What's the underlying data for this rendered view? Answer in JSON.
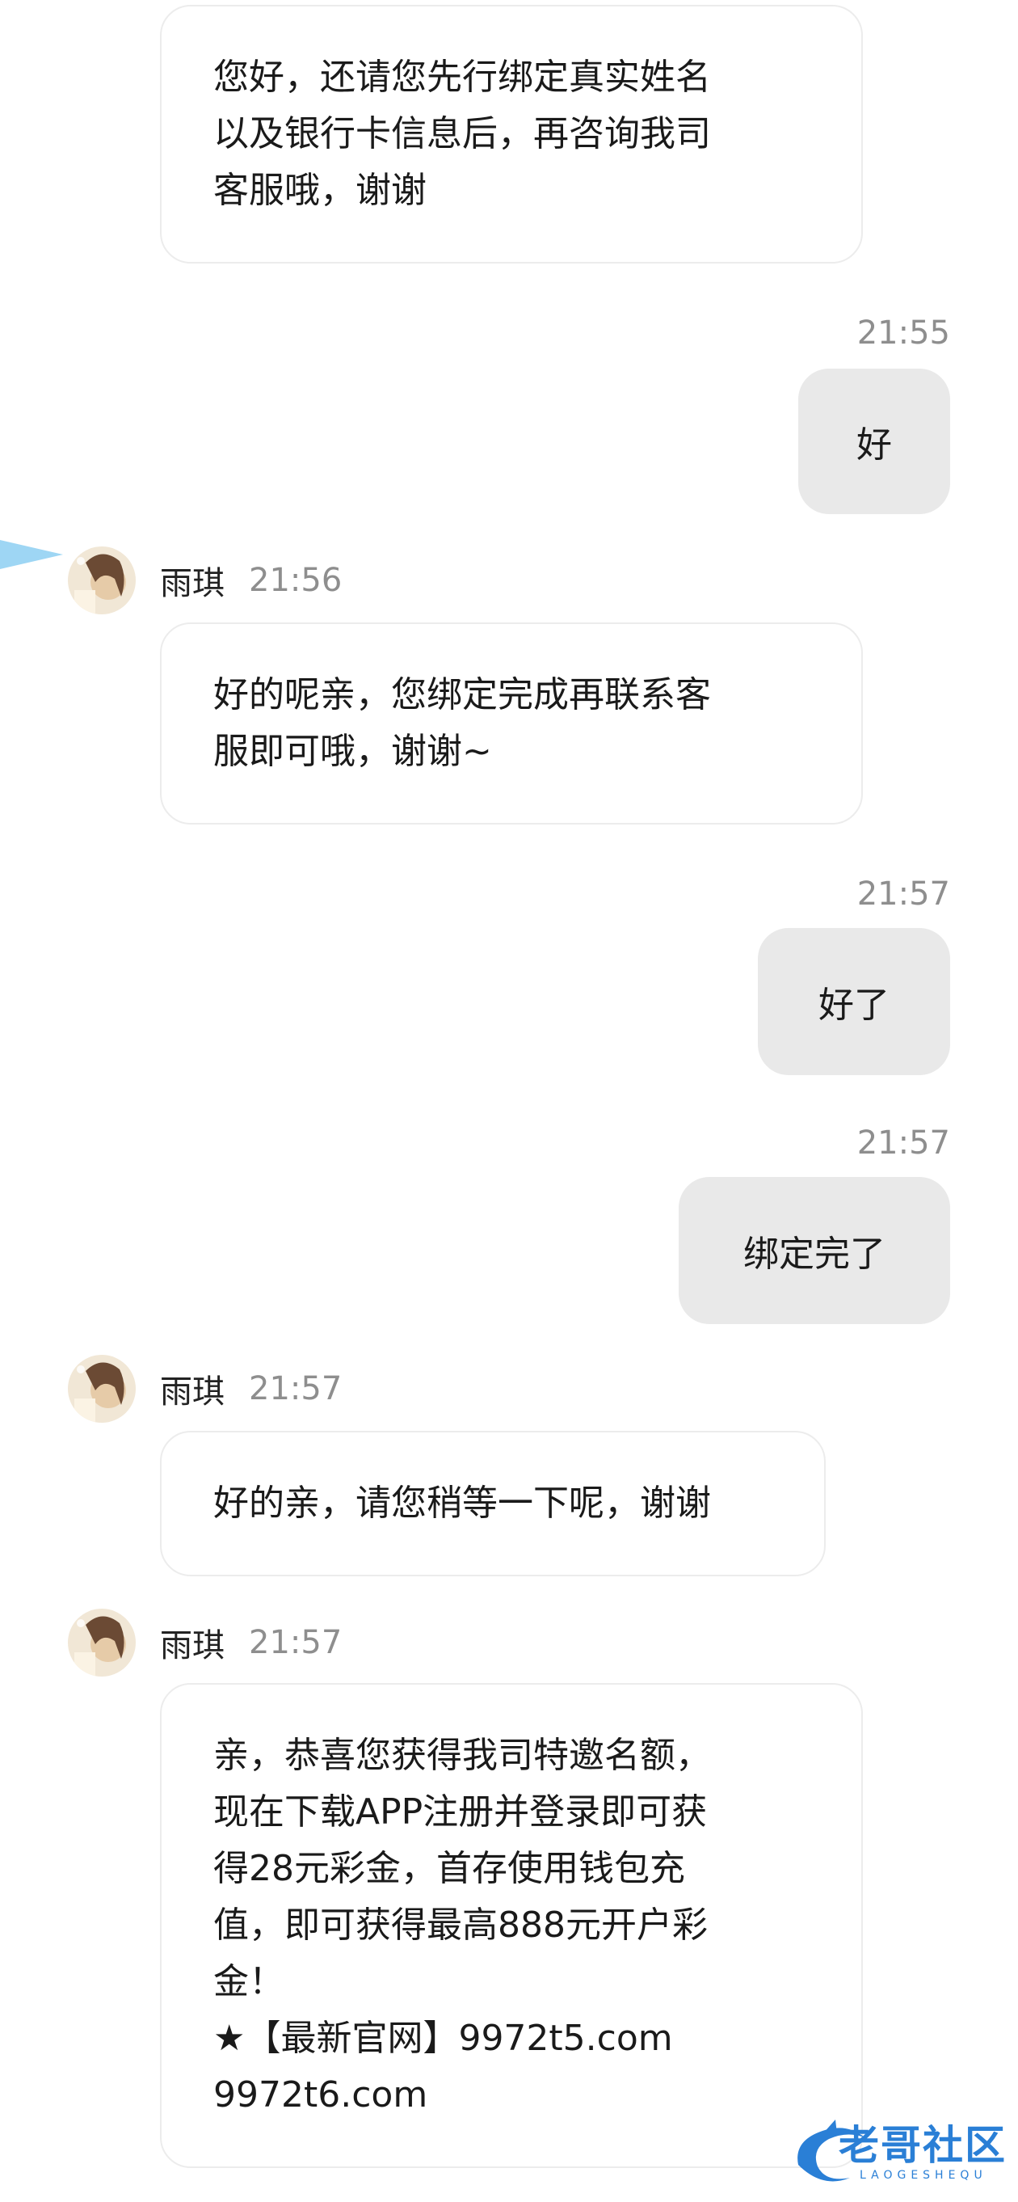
{
  "messages": [
    {
      "direction": "in",
      "text": "您好，还请您先行绑定真实姓名\n以及银行卡信息后，再咨询我司\n客服哦，谢谢"
    },
    {
      "direction": "out",
      "time": "21:55",
      "text": "好"
    },
    {
      "direction": "in",
      "sender": "雨琪",
      "time": "21:56",
      "text": "好的呢亲，您绑定完成再联系客\n服即可哦，谢谢~"
    },
    {
      "direction": "out",
      "time": "21:57",
      "text": "好了"
    },
    {
      "direction": "out",
      "time": "21:57",
      "text": "绑定完了"
    },
    {
      "direction": "in",
      "sender": "雨琪",
      "time": "21:57",
      "text": "好的亲，请您稍等一下呢，谢谢"
    },
    {
      "direction": "in",
      "sender": "雨琪",
      "time": "21:57",
      "text": "亲，恭喜您获得我司特邀名额，\n现在下载APP注册并登录即可获\n得28元彩金，首存使用钱包充\n值，即可获得最高888元开户彩\n金！\n★【最新官网】9972t5.com\n9972t6.com"
    }
  ],
  "watermark": {
    "text": "老哥社区",
    "subtext": "LAOGESHEQU"
  },
  "colors": {
    "outgoing_bubble": "#e9e9e9",
    "incoming_bubble": "#ffffff",
    "timestamp": "#8e8e8e",
    "watermark_blue": "#2a7fd6"
  }
}
